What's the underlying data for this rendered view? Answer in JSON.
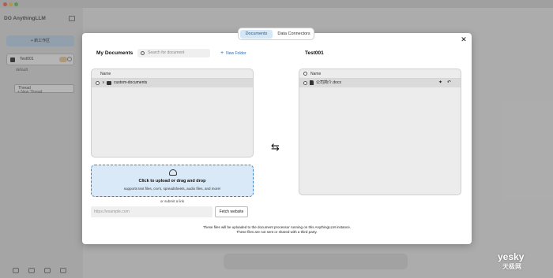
{
  "app": {
    "logo_text": "AnythingLLM",
    "new_workspace_label": "+ 新工作区",
    "workspace_name": "Test001",
    "threads": {
      "default": "default",
      "selected": "Thread",
      "new": "+ New Thread"
    }
  },
  "tabs": [
    {
      "label": "Documents",
      "active": true
    },
    {
      "label": "Data Connectors",
      "active": false
    }
  ],
  "my_documents": {
    "title": "My Documents",
    "search_placeholder": "Search for document",
    "new_folder_label": "New Folder",
    "column_name": "Name",
    "folders": [
      {
        "name": "custom-documents"
      }
    ]
  },
  "upload": {
    "title": "Click to upload or drag and drop",
    "subtitle": "supports text files, csv's, spreadsheets, audio files, and more!",
    "or_link": "or submit a link",
    "url_placeholder": "https://example.com",
    "fetch_label": "Fetch website"
  },
  "footnote": {
    "line1": "These files will be uploaded to the document processor running on this AnythingLLM instance.",
    "line2": "These files are not sent or shared with a third party."
  },
  "workspace_docs": {
    "title": "Test001",
    "column_name": "Name",
    "files": [
      {
        "name": "公司简介.docx"
      }
    ]
  },
  "watermark": {
    "main": "yesky",
    "sub": "天极网"
  },
  "colors": {
    "accent": "#3b82c4",
    "tab_active_bg": "#d5e6f5",
    "upload_bg": "#d9e9f7"
  },
  "icons": [
    "search-icon",
    "plus-icon",
    "folder-icon",
    "file-icon",
    "pin-icon",
    "undo-icon",
    "close-icon",
    "swap-icon",
    "cloud-upload-icon"
  ]
}
